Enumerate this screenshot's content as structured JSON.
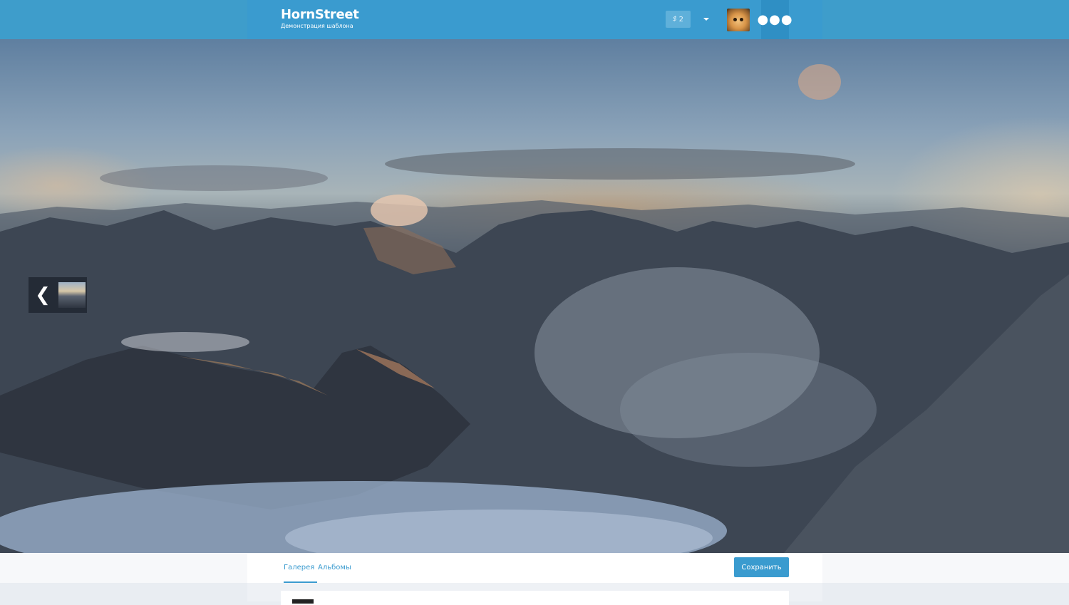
{
  "header": {
    "logo_title": "HornStreet",
    "logo_subtitle": "Демонстрация шаблона",
    "balance_icon": "dollar-icon",
    "balance_count": "2",
    "more_icon": "ellipsis-icon"
  },
  "cover": {
    "prev_icon": "chevron-left-icon",
    "prev_glyph": "❮"
  },
  "tabs": [
    {
      "label": "Галерея",
      "active": true
    },
    {
      "label": "Альбомы",
      "active": false
    }
  ],
  "actions": {
    "save_label": "Сохранить"
  },
  "colors": {
    "brand": "#3a9bcf",
    "header_bg": "#3e9dcb"
  }
}
